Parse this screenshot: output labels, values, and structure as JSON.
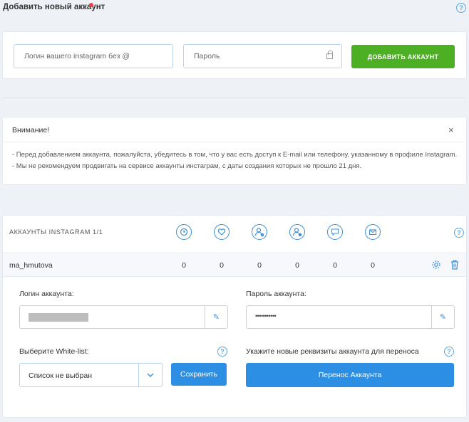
{
  "header": {
    "title": "Добавить новый аккаунт"
  },
  "add_form": {
    "login_placeholder": "Логин вашего instagram без @",
    "password_placeholder": "Пароль",
    "add_button": "ДОБАВИТЬ АККАУНТ"
  },
  "notice": {
    "title": "Внимание!",
    "close": "×",
    "lines": [
      "- Перед добавлением аккаунта, пожалуйста, убедитесь в том, что у вас есть доступ к E-mail или телефону, указанному в профиле Instagram.",
      "- Мы не рекомендуем продвигать на сервисе аккаунты инстаграм, с даты создания которых не прошло 21 дня."
    ]
  },
  "accounts": {
    "title": "АККАУНТЫ INSTAGRAM 1/1",
    "stat_icons": [
      "clock-icon",
      "heart-icon",
      "user-add-icon",
      "user-remove-icon",
      "comment-icon",
      "mail-icon"
    ],
    "rows": [
      {
        "username": "ma_hmutova",
        "stats": [
          "0",
          "0",
          "0",
          "0",
          "0",
          "0"
        ]
      }
    ],
    "details": {
      "login_label": "Логин аккаунта:",
      "password_label": "Пароль аккаунта:",
      "password_value": "•••••••••••",
      "whitelist_label": "Выберите White-list:",
      "whitelist_selected": "Список не выбран",
      "save_button": "Сохранить",
      "transfer_label": "Укажите новые реквизиты аккаунта для переноса",
      "transfer_button": "Перенос Аккаунта"
    }
  },
  "colors": {
    "green": "#4caf24",
    "blue": "#2c8fe3",
    "icon_blue": "#3d8fd8",
    "alert_dot": "#e8404a"
  }
}
